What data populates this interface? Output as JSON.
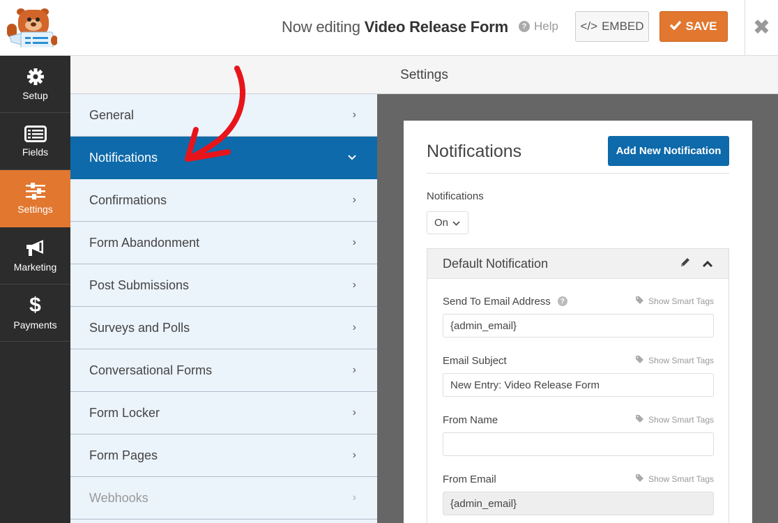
{
  "header": {
    "title_prefix": "Now editing",
    "form_name": "Video Release Form",
    "help_label": "Help",
    "embed_label": "EMBED",
    "embed_icon": "</>",
    "save_label": "SAVE",
    "close_icon": "✖"
  },
  "left_nav": {
    "items": [
      {
        "label": "Setup",
        "icon": "gear-icon"
      },
      {
        "label": "Fields",
        "icon": "fields-list-icon"
      },
      {
        "label": "Settings",
        "icon": "sliders-icon",
        "active": true
      },
      {
        "label": "Marketing",
        "icon": "megaphone-icon"
      },
      {
        "label": "Payments",
        "icon": "dollar-icon"
      }
    ]
  },
  "settings_header": {
    "title": "Settings"
  },
  "settings_menu": {
    "items": [
      {
        "label": "General",
        "chevron": "›"
      },
      {
        "label": "Notifications",
        "chevron": "⌄",
        "active": true
      },
      {
        "label": "Confirmations",
        "chevron": "›"
      },
      {
        "label": "Form Abandonment",
        "chevron": "›"
      },
      {
        "label": "Post Submissions",
        "chevron": "›"
      },
      {
        "label": "Surveys and Polls",
        "chevron": "›"
      },
      {
        "label": "Conversational Forms",
        "chevron": "›"
      },
      {
        "label": "Form Locker",
        "chevron": "›"
      },
      {
        "label": "Form Pages",
        "chevron": "›"
      },
      {
        "label": "Webhooks",
        "chevron": "›",
        "muted": true
      }
    ]
  },
  "notifications_panel": {
    "title": "Notifications",
    "add_button_label": "Add New Notification",
    "toggle_label": "Notifications",
    "toggle_value": "On",
    "default_notification": {
      "title": "Default Notification",
      "smart_tags_label": "Show Smart Tags",
      "fields": [
        {
          "label": "Send To Email Address",
          "value": "{admin_email}",
          "has_help": true,
          "readonly": false
        },
        {
          "label": "Email Subject",
          "value": "New Entry: Video Release Form",
          "has_help": false,
          "readonly": false
        },
        {
          "label": "From Name",
          "value": "",
          "has_help": false,
          "readonly": false
        },
        {
          "label": "From Email",
          "value": "{admin_email}",
          "has_help": false,
          "readonly": true
        }
      ]
    }
  },
  "colors": {
    "brand_orange": "#e27730",
    "brand_blue": "#0e6aaa",
    "nav_dark": "#2c2c2c",
    "annotation_red": "#e8141b"
  }
}
